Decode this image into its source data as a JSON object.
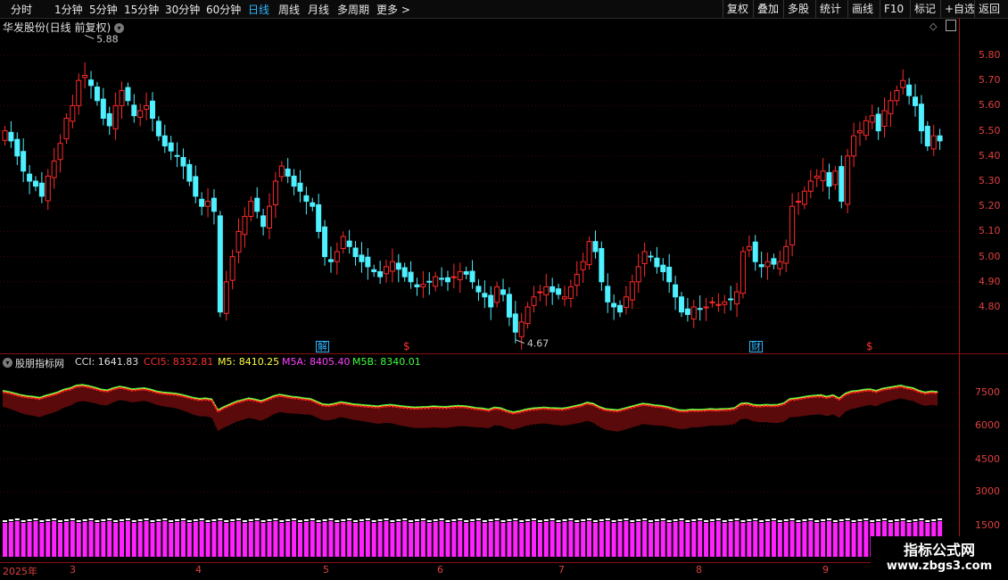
{
  "toolbar": {
    "periods": [
      "分时",
      "1分钟",
      "5分钟",
      "15分钟",
      "30分钟",
      "60分钟",
      "日线",
      "周线",
      "月线",
      "多周期",
      "更多 >"
    ],
    "active": "日线",
    "right_buttons": [
      "复权",
      "叠加",
      "多股",
      "统计",
      "画线",
      "F10",
      "+自选",
      "返回"
    ],
    "right_buttons_pre_label": "标记"
  },
  "main_panel": {
    "title": "华发股份(日线 前复权)",
    "high_marker": "5.88",
    "low_marker": "4.67",
    "yaxis": [
      "5.80",
      "5.70",
      "5.60",
      "5.50",
      "5.40",
      "5.30",
      "5.20",
      "5.10",
      "5.00",
      "4.90",
      "4.80"
    ],
    "event_markers": [
      {
        "text": "解",
        "color": "#2fb7ff"
      },
      {
        "text": "$",
        "color": "#ff3030"
      },
      {
        "text": "财",
        "color": "#2fb7ff"
      },
      {
        "text": "$",
        "color": "#ff3030"
      }
    ]
  },
  "indicator_panel": {
    "name": "股朋指标网",
    "values": [
      {
        "label": "CCI: 1641.83",
        "color": "#e0e0e0"
      },
      {
        "label": "CCI5: 8332.81",
        "color": "#ff3030"
      },
      {
        "label": "M5: 8410.25",
        "color": "#ffff40"
      },
      {
        "label": "M5A: 8405.40",
        "color": "#ff40ff"
      },
      {
        "label": "M5B: 8340.01",
        "color": "#40ff40"
      }
    ],
    "yaxis": [
      "7500",
      "6000",
      "4500",
      "3000",
      "1500"
    ]
  },
  "date_axis": [
    "2025年",
    "3",
    "4",
    "5",
    "6",
    "7",
    "8",
    "9"
  ],
  "watermark": {
    "line1": "指标公式网",
    "line2": "www.zbgs3.com"
  },
  "colors": {
    "up": "#ff2a2a",
    "down": "#4ff0ff",
    "axis": "#e04040",
    "bar": "#ff22ff"
  }
}
